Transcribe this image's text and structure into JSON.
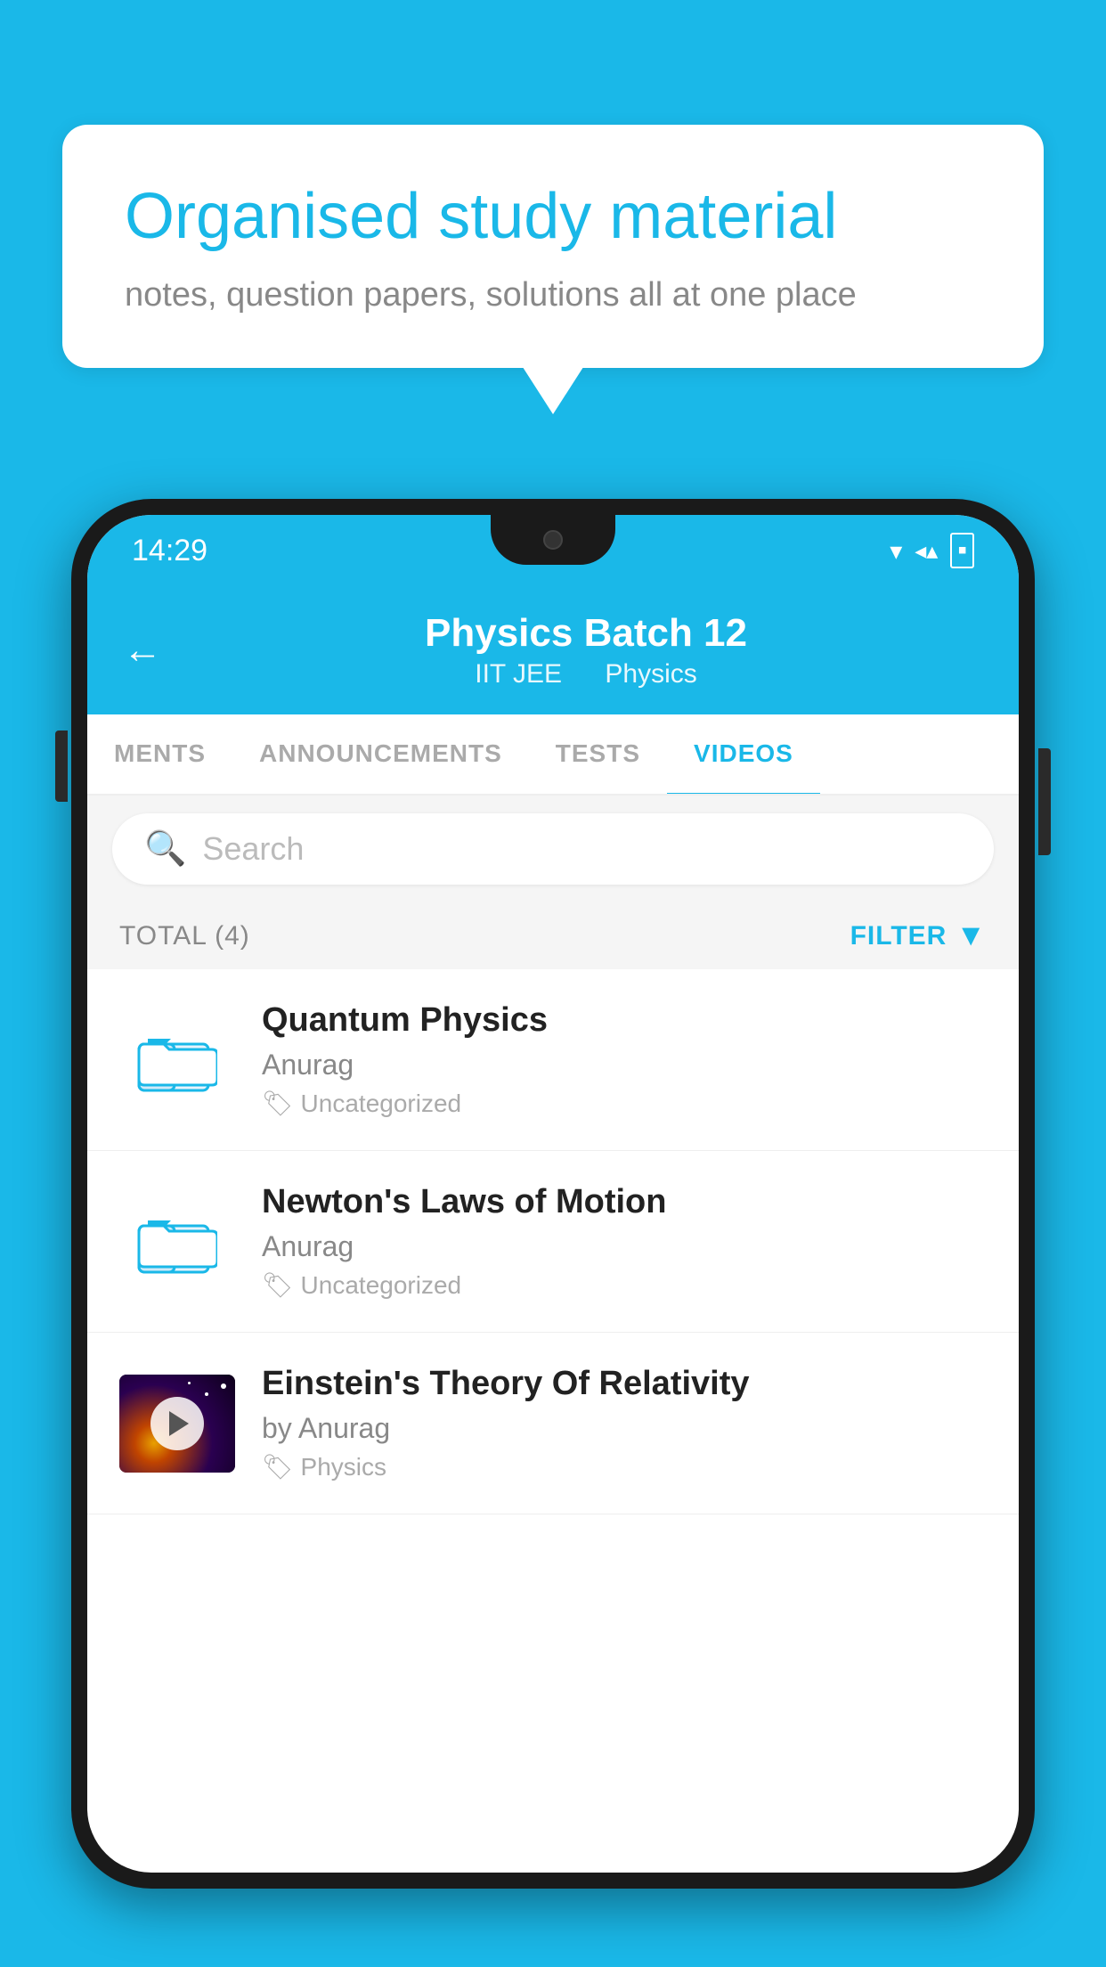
{
  "background_color": "#1ab8e8",
  "speech_bubble": {
    "title": "Organised study material",
    "subtitle": "notes, question papers, solutions all at one place"
  },
  "status_bar": {
    "time": "14:29",
    "icons": [
      "wifi",
      "signal",
      "battery"
    ]
  },
  "app_header": {
    "title": "Physics Batch 12",
    "subtitle1": "IIT JEE",
    "subtitle2": "Physics",
    "back_label": "←"
  },
  "tabs": [
    {
      "label": "MENTS",
      "active": false
    },
    {
      "label": "ANNOUNCEMENTS",
      "active": false
    },
    {
      "label": "TESTS",
      "active": false
    },
    {
      "label": "VIDEOS",
      "active": true
    }
  ],
  "search": {
    "placeholder": "Search"
  },
  "filter_bar": {
    "total_label": "TOTAL (4)",
    "filter_label": "FILTER"
  },
  "videos": [
    {
      "title": "Quantum Physics",
      "author": "Anurag",
      "tag": "Uncategorized",
      "has_thumbnail": false
    },
    {
      "title": "Newton's Laws of Motion",
      "author": "Anurag",
      "tag": "Uncategorized",
      "has_thumbnail": false
    },
    {
      "title": "Einstein's Theory Of Relativity",
      "author": "by Anurag",
      "tag": "Physics",
      "has_thumbnail": true
    }
  ]
}
